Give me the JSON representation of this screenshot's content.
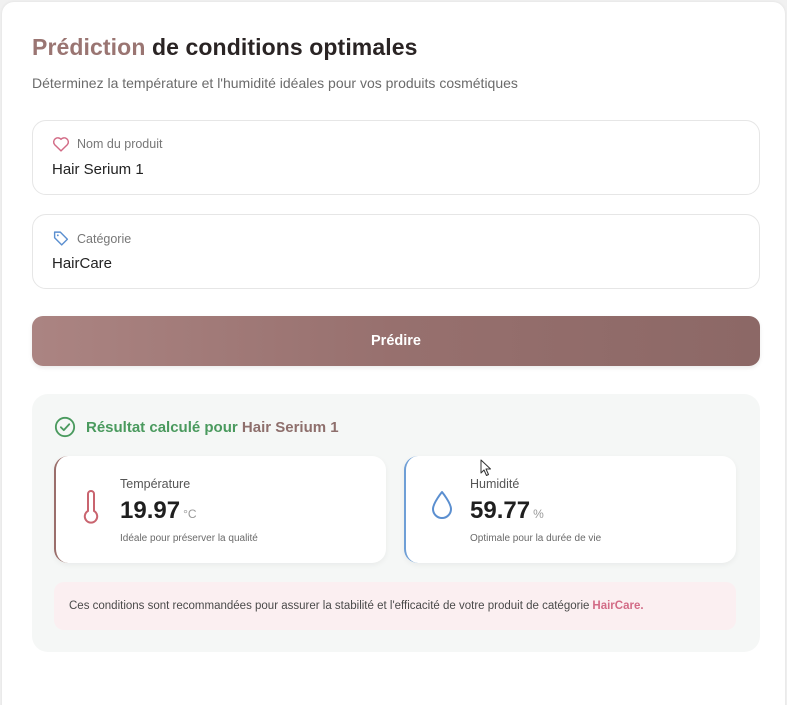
{
  "header": {
    "title_accent": "Prédiction",
    "title_rest": "de conditions optimales",
    "subtitle": "Déterminez la température et l'humidité idéales pour vos produits cosmétiques"
  },
  "form": {
    "product": {
      "label": "Nom du produit",
      "value": "Hair Serium 1",
      "icon": "heart-icon"
    },
    "category": {
      "label": "Catégorie",
      "value": "HairCare",
      "icon": "tag-icon"
    },
    "submit_label": "Prédire"
  },
  "result": {
    "heading_prefix": "Résultat calculé pour",
    "product_name": "Hair Serium 1",
    "temperature": {
      "label": "Température",
      "value": "19.97",
      "unit": "°C",
      "note": "Idéale pour préserver la qualité",
      "icon": "thermometer-icon"
    },
    "humidity": {
      "label": "Humidité",
      "value": "59.77",
      "unit": "%",
      "note": "Optimale pour la durée de vie",
      "icon": "droplet-icon"
    },
    "advice_text": "Ces conditions sont recommandées pour assurer la stabilité et l'efficacité de votre produit de catégorie",
    "advice_category": "HairCare."
  },
  "colors": {
    "accent": "#9a7572",
    "success": "#4a9a5e",
    "highlight": "#d26b86",
    "humidity_blue": "#6f9fd6"
  }
}
